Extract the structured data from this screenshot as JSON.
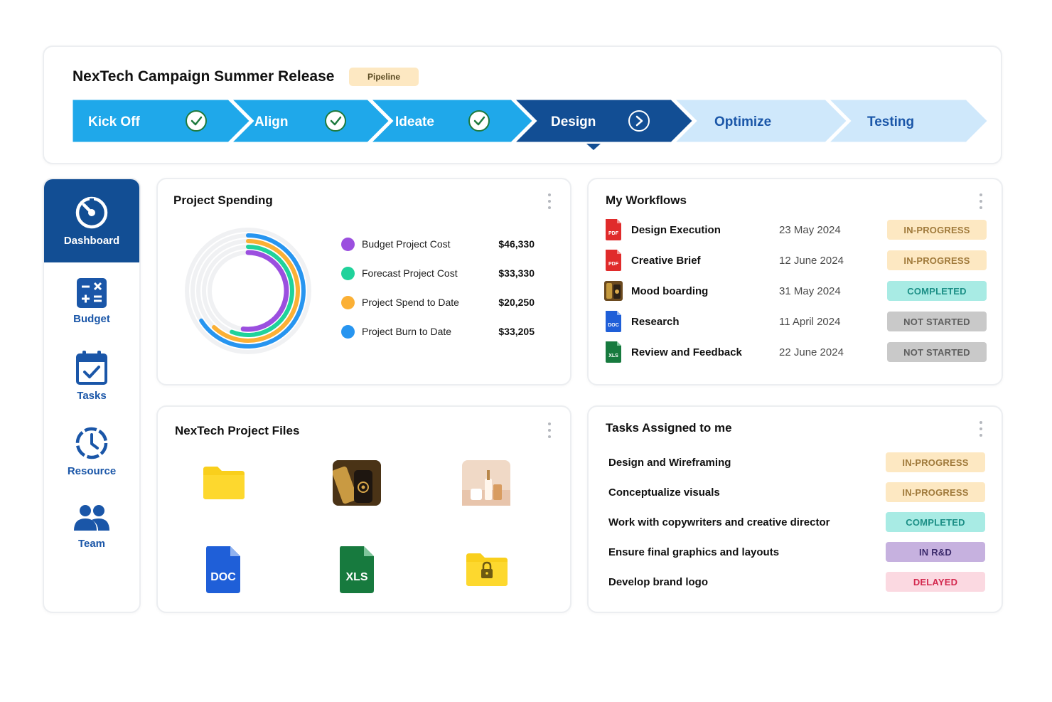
{
  "header": {
    "title": "NexTech Campaign Summer Release",
    "badge": "Pipeline",
    "stages": [
      {
        "label": "Kick Off",
        "state": "done"
      },
      {
        "label": "Align",
        "state": "done"
      },
      {
        "label": "Ideate",
        "state": "done"
      },
      {
        "label": "Design",
        "state": "current"
      },
      {
        "label": "Optimize",
        "state": "upcoming"
      },
      {
        "label": "Testing",
        "state": "upcoming"
      }
    ]
  },
  "colors": {
    "stage_done": "#1fa8ea",
    "stage_current": "#124e94",
    "stage_upcoming": "#cfe8fb",
    "sidebar_active": "#124e94",
    "nav_text": "#1a56a8"
  },
  "sidebar": {
    "items": [
      {
        "label": "Dashboard",
        "icon": "gauge-icon",
        "active": true
      },
      {
        "label": "Budget",
        "icon": "calculator-icon",
        "active": false
      },
      {
        "label": "Tasks",
        "icon": "calendar-check-icon",
        "active": false
      },
      {
        "label": "Resource",
        "icon": "clock-icon",
        "active": false
      },
      {
        "label": "Team",
        "icon": "team-icon",
        "active": false
      }
    ]
  },
  "spending": {
    "title": "Project Spending",
    "items": [
      {
        "label": "Budget Project Cost",
        "value": "$46,330",
        "color": "#9b4fdf",
        "ring_fraction": 0.52
      },
      {
        "label": "Forecast Project Cost",
        "value": "$33,330",
        "color": "#20d29b",
        "ring_fraction": 0.56
      },
      {
        "label": "Project Spend to Date",
        "value": "$20,250",
        "color": "#fbb035",
        "ring_fraction": 0.62
      },
      {
        "label": "Project Burn to Date",
        "value": "$33,205",
        "color": "#2795f0",
        "ring_fraction": 0.66
      }
    ]
  },
  "workflows": {
    "title": "My Workflows",
    "items": [
      {
        "name": "Design Execution",
        "date": "23 May 2024",
        "status": "IN-PROGRESS",
        "type": "PDF"
      },
      {
        "name": "Creative Brief",
        "date": "12 June 2024",
        "status": "IN-PROGRESS",
        "type": "PDF"
      },
      {
        "name": "Mood boarding",
        "date": "31 May 2024",
        "status": "COMPLETED",
        "type": "IMG"
      },
      {
        "name": "Research",
        "date": "11 April 2024",
        "status": "NOT STARTED",
        "type": "DOC"
      },
      {
        "name": "Review and Feedback",
        "date": "22 June 2024",
        "status": "NOT STARTED",
        "type": "XLS"
      }
    ]
  },
  "files": {
    "title": "NexTech Project Files",
    "items": [
      {
        "kind": "folder",
        "icon": "folder-icon"
      },
      {
        "kind": "image",
        "icon": "product-photo-icon"
      },
      {
        "kind": "image",
        "icon": "product-photo-icon"
      },
      {
        "kind": "doc",
        "label": "DOC",
        "icon": "doc-file-icon"
      },
      {
        "kind": "xls",
        "label": "XLS",
        "icon": "xls-file-icon"
      },
      {
        "kind": "locked-folder",
        "icon": "locked-folder-icon"
      }
    ]
  },
  "tasks": {
    "title": "Tasks Assigned to me",
    "items": [
      {
        "name": "Design and Wireframing",
        "status": "IN-PROGRESS"
      },
      {
        "name": "Conceptualize visuals",
        "status": "IN-PROGRESS"
      },
      {
        "name": "Work with copywriters and creative director",
        "status": "COMPLETED"
      },
      {
        "name": "Ensure final graphics and layouts",
        "status": "IN R&D"
      },
      {
        "name": "Develop brand logo",
        "status": "DELAYED"
      }
    ]
  }
}
